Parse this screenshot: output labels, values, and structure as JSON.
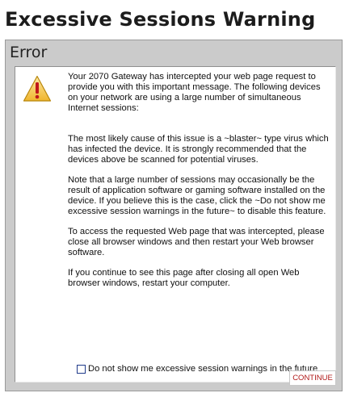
{
  "page": {
    "title": "Excessive Sessions Warning"
  },
  "panel": {
    "header": "Error"
  },
  "message": {
    "intro": "Your 2070 Gateway has intercepted your web page request to provide you with this important message. The following devices on your network are using a large number of simultaneous Internet sessions:",
    "cause": "The most likely cause of this issue is a ~blaster~ type virus which has infected the device. It is strongly recommended that the devices above be scanned for potential viruses.",
    "note": "Note that a large number of sessions may occasionally be the result of application software or gaming software installed on the device. If you believe this is the case, click the ~Do not show me excessive session warnings in the future~ to disable this feature.",
    "access": "To access the requested Web page that was intercepted, please close all browser windows and then restart your Web browser software.",
    "restart": "If you continue to see this page after closing all open Web browser windows, restart your computer."
  },
  "optout": {
    "label": "Do not show me excessive session warnings in the future",
    "checked": false
  },
  "actions": {
    "continue_label": "CONTINUE"
  },
  "icons": {
    "warning": "warning-triangle-icon"
  },
  "colors": {
    "panel_bg": "#cbcbcb",
    "warning_fill": "#f2c94c",
    "warning_mark": "#c0171b",
    "button_text": "#b01818"
  }
}
